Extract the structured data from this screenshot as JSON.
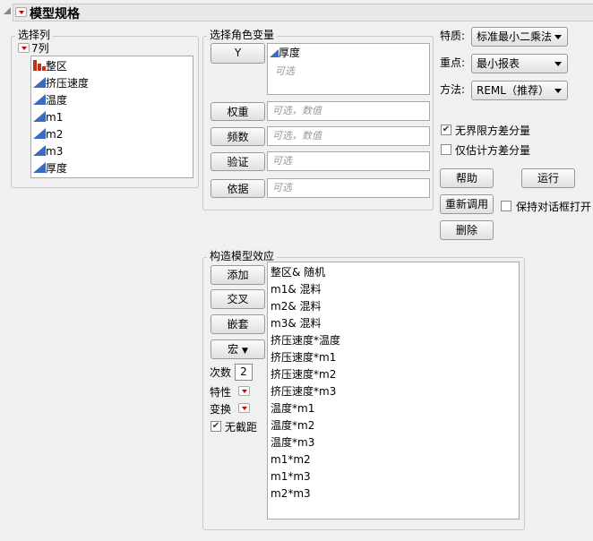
{
  "title": "模型规格",
  "select_columns": {
    "label": "选择列",
    "count_label": "7列",
    "columns": [
      {
        "name": "整区",
        "type": "nominal"
      },
      {
        "name": "挤压速度",
        "type": "continuous"
      },
      {
        "name": "温度",
        "type": "continuous"
      },
      {
        "name": "m1",
        "type": "continuous"
      },
      {
        "name": "m2",
        "type": "continuous"
      },
      {
        "name": "m3",
        "type": "continuous"
      },
      {
        "name": "厚度",
        "type": "continuous"
      }
    ]
  },
  "roles": {
    "label": "选择角色变量",
    "y": {
      "button": "Y",
      "value": "厚度",
      "placeholder": "可选"
    },
    "weight": {
      "button": "权重",
      "placeholder": "可选，数值"
    },
    "freq": {
      "button": "频数",
      "placeholder": "可选，数值"
    },
    "validation": {
      "button": "验证",
      "placeholder": "可选"
    },
    "by": {
      "button": "依据",
      "placeholder": "可选"
    }
  },
  "options": {
    "personality": {
      "label": "特质:",
      "value": "标准最小二乘法"
    },
    "emphasis": {
      "label": "重点:",
      "value": "最小报表"
    },
    "method": {
      "label": "方法:",
      "value": "REML（推荐）"
    },
    "unbounded": {
      "label": "无界限方差分量",
      "checked": true
    },
    "estimate_only": {
      "label": "仅估计方差分量",
      "checked": false
    },
    "help": "帮助",
    "run": "运行",
    "recall": "重新调用",
    "remove": "删除",
    "keep_open": {
      "label": "保持对话框打开",
      "checked": false
    }
  },
  "effects": {
    "label": "构造模型效应",
    "add": "添加",
    "cross": "交叉",
    "nest": "嵌套",
    "macros": "宏",
    "degree_label": "次数",
    "degree": "2",
    "attributes": "特性",
    "transform": "变换",
    "no_intercept": {
      "label": "无截距",
      "checked": true
    },
    "items": [
      "整区& 随机",
      "m1& 混料",
      "m2& 混料",
      "m3& 混料",
      "挤压速度*温度",
      "挤压速度*m1",
      "挤压速度*m2",
      "挤压速度*m3",
      "温度*m1",
      "温度*m2",
      "温度*m3",
      "m1*m2",
      "m1*m3",
      "m2*m3"
    ]
  }
}
